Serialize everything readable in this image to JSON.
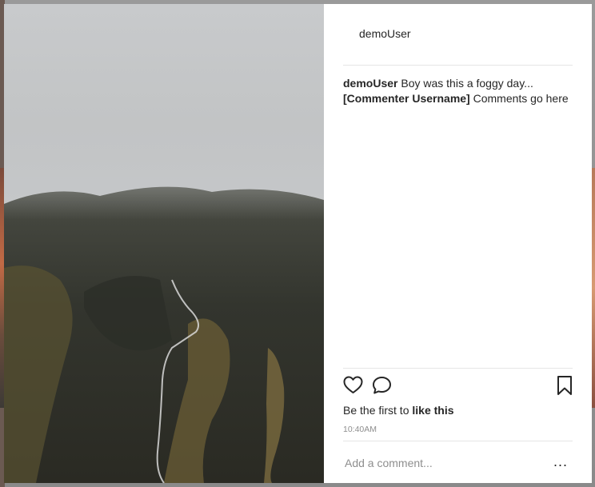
{
  "post": {
    "author": "demoUser",
    "caption_user": "demoUser",
    "caption_text": "Boy was this a foggy day...",
    "comment_user": "[Commenter Username]",
    "comment_text": "Comments go here",
    "likes_prefix": "Be the first to",
    "likes_action": "like this",
    "timestamp": "10:40AM"
  },
  "comment_box": {
    "placeholder": "Add a comment...",
    "more_label": "..."
  },
  "icons": {
    "like": "heart-icon",
    "comment": "speech-bubble-icon",
    "save": "bookmark-icon"
  },
  "colors": {
    "text": "#262626",
    "muted": "#8e8e8e",
    "divider": "#e6e6e6"
  }
}
